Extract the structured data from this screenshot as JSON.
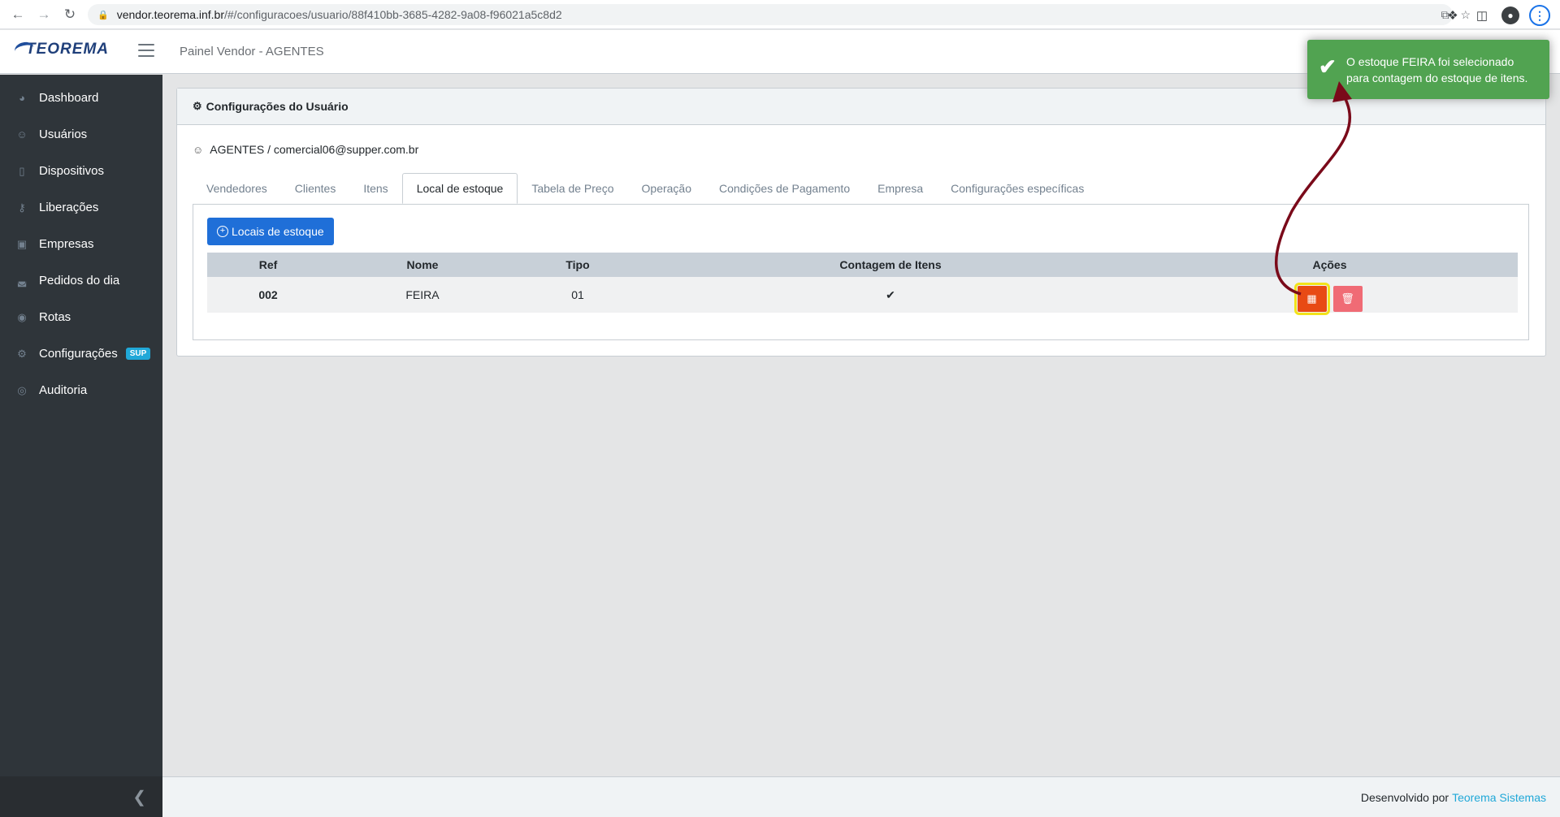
{
  "browser": {
    "url_host": "vendor.teorema.inf.br",
    "url_path": "/#/configuracoes/usuario/88f410bb-3685-4282-9a08-f96021a5c8d2"
  },
  "header": {
    "logo": "TEOREMA",
    "panel_title": "Painel Vendor - AGENTES"
  },
  "sidebar": {
    "items": [
      {
        "label": "Dashboard",
        "icon": "speedometer-icon"
      },
      {
        "label": "Usuários",
        "icon": "user-icon"
      },
      {
        "label": "Dispositivos",
        "icon": "phone-icon"
      },
      {
        "label": "Liberações",
        "icon": "key-icon"
      },
      {
        "label": "Empresas",
        "icon": "briefcase-icon"
      },
      {
        "label": "Pedidos do dia",
        "icon": "basket-icon"
      },
      {
        "label": "Rotas",
        "icon": "map-pin-icon"
      },
      {
        "label": "Configurações",
        "icon": "gear-icon",
        "badge": "SUP"
      },
      {
        "label": "Auditoria",
        "icon": "eye-icon"
      }
    ]
  },
  "card": {
    "title": "Configurações do Usuário",
    "user_line": "AGENTES / comercial06@supper.com.br"
  },
  "tabs": [
    {
      "label": "Vendedores",
      "active": false
    },
    {
      "label": "Clientes",
      "active": false
    },
    {
      "label": "Itens",
      "active": false
    },
    {
      "label": "Local de estoque",
      "active": true
    },
    {
      "label": "Tabela de Preço",
      "active": false
    },
    {
      "label": "Operação",
      "active": false
    },
    {
      "label": "Condições de Pagamento",
      "active": false
    },
    {
      "label": "Empresa",
      "active": false
    },
    {
      "label": "Configurações específicas",
      "active": false
    }
  ],
  "stock": {
    "add_button": "Locais de estoque",
    "columns": {
      "ref": "Ref",
      "nome": "Nome",
      "tipo": "Tipo",
      "contagem": "Contagem de Itens",
      "acoes": "Ações"
    },
    "rows": [
      {
        "ref": "002",
        "nome": "FEIRA",
        "tipo": "01",
        "contagem": "✔"
      }
    ]
  },
  "toast": {
    "line1": "O estoque FEIRA foi selecionado",
    "line2": "para contagem do estoque de itens."
  },
  "footer": {
    "text": "Desenvolvido por",
    "link": "Teorema Sistemas"
  },
  "colors": {
    "sidebar": "#2f353a",
    "primary": "#1f6fd8",
    "toast": "#51a351",
    "calc_button": "#e84a14",
    "delete_button": "#f06b75",
    "highlight": "#f2e31a",
    "annotation_arrow": "#7a0a1a"
  }
}
